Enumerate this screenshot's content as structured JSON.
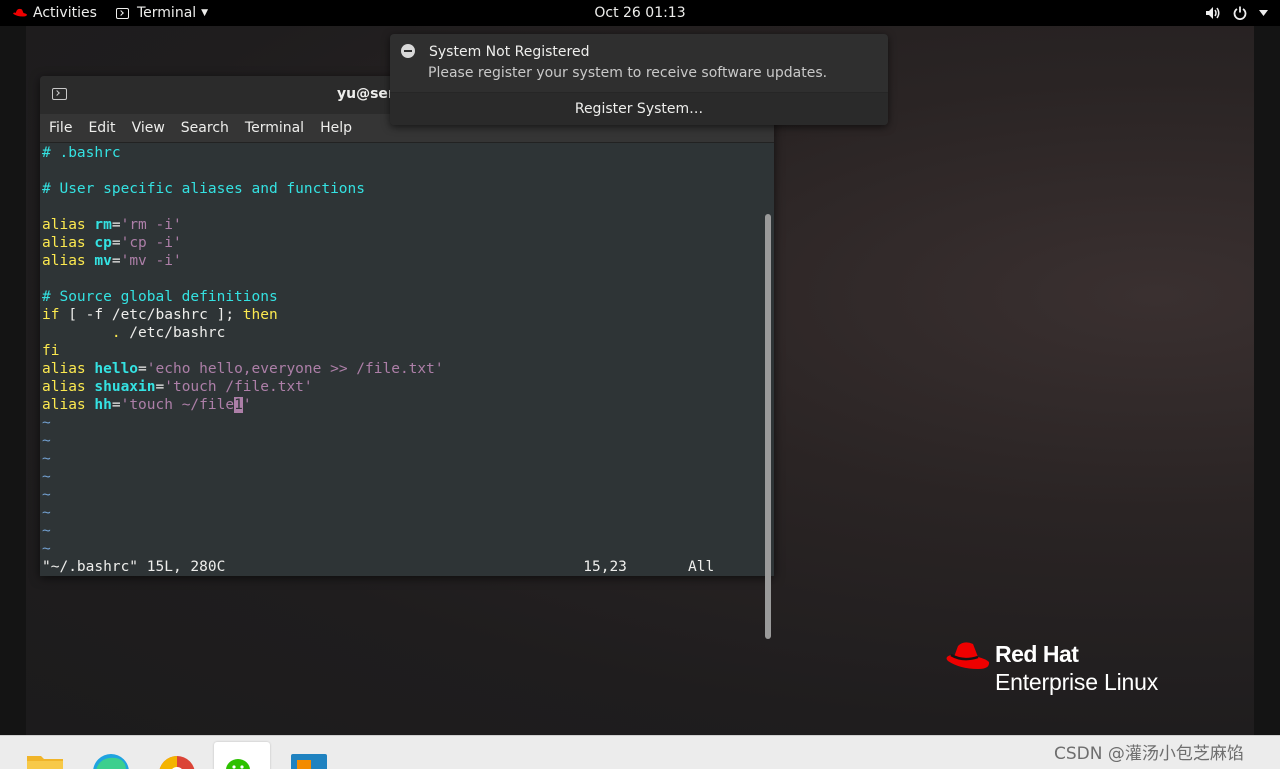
{
  "topbar": {
    "activities_label": "Activities",
    "app_menu_label": "Terminal",
    "clock": "Oct 26  01:13",
    "tray_icons": [
      "volume-icon",
      "power-icon",
      "chevron-down-icon"
    ]
  },
  "notification": {
    "title": "System Not Registered",
    "body": "Please register your system to receive software updates.",
    "action_label": "Register System…"
  },
  "terminal": {
    "title": "yu@ser",
    "menu": [
      "File",
      "Edit",
      "View",
      "Search",
      "Terminal",
      "Help"
    ],
    "lines": [
      "# .bashrc",
      "",
      "# User specific aliases and functions",
      "",
      "alias rm='rm -i'",
      "alias cp='cp -i'",
      "alias mv='mv -i'",
      "",
      "# Source global definitions",
      "if [ -f /etc/bashrc ]; then",
      "        . /etc/bashrc",
      "fi",
      "alias hello='echo hello,everyone >> /file.txt'",
      "alias shuaxin='touch /file.txt'",
      "alias hh='touch ~/file1'",
      "~",
      "~",
      "~",
      "~",
      "~",
      "~",
      "~",
      "~"
    ],
    "status_left": "\"~/.bashrc\" 15L, 280C",
    "status_pos": "15,23",
    "status_right": "All"
  },
  "branding": {
    "line1": "Red Hat",
    "line2": "Enterprise Linux"
  },
  "watermark": "CSDN @灌汤小包芝麻馅",
  "colors": {
    "terminal_bg": "#2e3436",
    "comment": "#34e2e2",
    "keyword": "#fce94f",
    "string": "#ad7fa8",
    "brand_red": "#ee0000"
  }
}
